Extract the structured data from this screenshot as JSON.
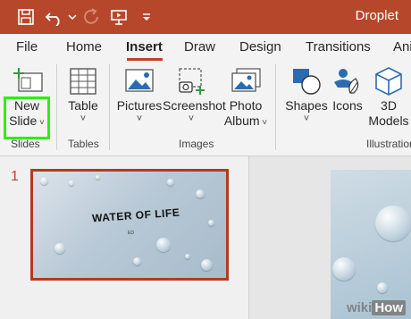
{
  "window": {
    "document_title": "Droplet"
  },
  "quick_access": [
    {
      "name": "save-icon"
    },
    {
      "name": "undo-icon"
    },
    {
      "name": "undo-dropdown-icon"
    },
    {
      "name": "redo-icon"
    },
    {
      "name": "present-from-start-icon"
    },
    {
      "name": "customize-toolbar-icon"
    }
  ],
  "tabs": [
    "File",
    "Home",
    "Insert",
    "Draw",
    "Design",
    "Transitions",
    "Ani"
  ],
  "active_tab": "Insert",
  "ribbon": {
    "new_slide": {
      "line1": "New",
      "line2": "Slide"
    },
    "table": "Table",
    "pictures": "Pictures",
    "screenshot": "Screenshot",
    "photo_album": {
      "line1": "Photo",
      "line2": "Album"
    },
    "shapes": "Shapes",
    "icons": "Icons",
    "models_3d": {
      "line1": "3D",
      "line2": "Models"
    },
    "groups": {
      "slides": "Slides",
      "tables": "Tables",
      "images": "Images",
      "illustrations": "Illustration"
    }
  },
  "thumbnails": [
    {
      "number": "1",
      "title": "WATER OF LIFE",
      "subtitle": "ED"
    }
  ],
  "watermark": {
    "left": "wiki",
    "right": "How"
  },
  "colors": {
    "accent": "#b7472a",
    "highlight": "#2eee15",
    "ribbon_bg": "#f3f3f3"
  }
}
